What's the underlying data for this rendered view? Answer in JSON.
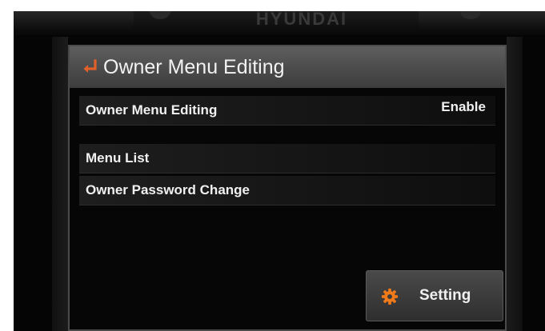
{
  "header": {
    "brand": "HYUNDAI"
  },
  "panel": {
    "title": "Owner Menu Editing",
    "back_icon": "return-arrow-icon",
    "accent_color": "#e0602a"
  },
  "menu": {
    "items": [
      {
        "label": "Owner Menu Editing",
        "value": "Enable"
      },
      {
        "label": "Menu List",
        "value": ""
      },
      {
        "label": "Owner Password Change",
        "value": ""
      }
    ]
  },
  "footer": {
    "setting_label": "Setting",
    "setting_icon": "gear-icon"
  }
}
